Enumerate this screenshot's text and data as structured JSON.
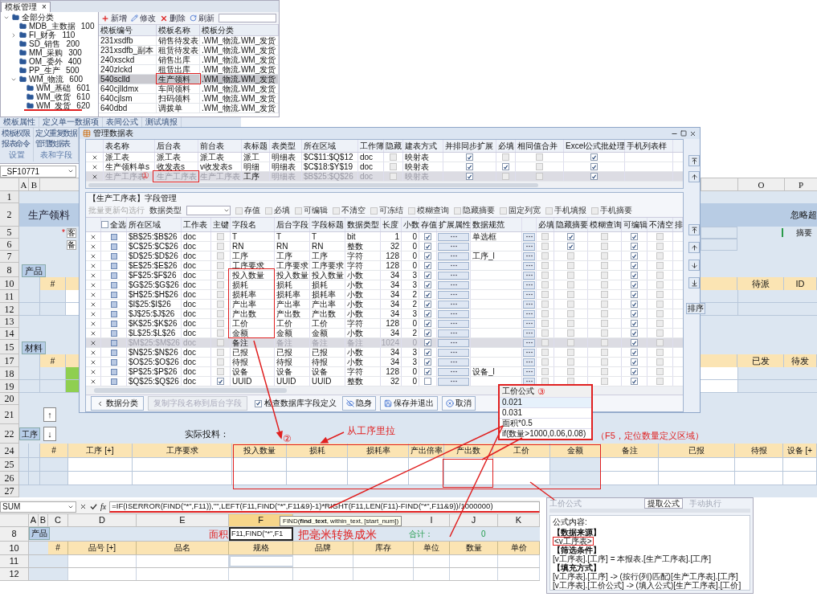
{
  "template_manager": {
    "tab": "模板管理",
    "close": "×",
    "tree": [
      {
        "label": "全部分类",
        "expanded": true,
        "children": [
          {
            "label": "MDB_主数据",
            "code": "100"
          },
          {
            "label": "FI_财务",
            "code": "110",
            "expanded": false
          },
          {
            "label": "SD_销售",
            "code": "200"
          },
          {
            "label": "MM_采购",
            "code": "300"
          },
          {
            "label": "OM_委外",
            "code": "400"
          },
          {
            "label": "PP_生产",
            "code": "500"
          },
          {
            "label": "WM_物流",
            "code": "600",
            "expanded": true,
            "children": [
              {
                "label": "WM_基础",
                "code": "601"
              },
              {
                "label": "WM_收货",
                "code": "610"
              },
              {
                "label": "WM_发货",
                "code": "620"
              }
            ]
          }
        ]
      }
    ],
    "toolbar": [
      {
        "kind": "add",
        "label": "新增"
      },
      {
        "kind": "edit",
        "label": "修改"
      },
      {
        "kind": "delete",
        "label": "删除"
      },
      {
        "kind": "refresh",
        "label": "刷新"
      }
    ],
    "columns": [
      "模板编号",
      "模板名称",
      "模板分类"
    ],
    "rows": [
      {
        "code": "231xsdfb",
        "name": "销售待发表",
        "category": ".WM_物流.WM_发货",
        "selected": false
      },
      {
        "code": "231xsdfb_副本",
        "name": "租赁待发表",
        "category": ".WM_物流.WM_发货",
        "selected": false
      },
      {
        "code": "240xsckd",
        "name": "销售出库",
        "category": ".WM_物流.WM_发货",
        "selected": false
      },
      {
        "code": "240zlckd",
        "name": "租赁出库",
        "category": ".WM_物流.WM_发货",
        "selected": false
      },
      {
        "code": "540sclld",
        "name": "生产领料",
        "category": ".WM_物流.WM_发货",
        "selected": true
      },
      {
        "code": "640cjlldmx",
        "name": "车间领料",
        "category": ".WM_物流.WM_发货",
        "selected": false
      },
      {
        "code": "640cjlsm",
        "name": "扫码领料",
        "category": ".WM_物流.WM_发货",
        "selected": false
      },
      {
        "code": "640dbd",
        "name": "调拨单",
        "category": ".WM_物流.WM_发货",
        "selected": false
      }
    ]
  },
  "ribbon": {
    "tabs": [
      "模板属性",
      "定义单一数据项",
      "表间公式",
      "测试填报"
    ],
    "groups": [
      {
        "items": [
          "模板权限",
          "报表命令"
        ],
        "label": "设置"
      },
      {
        "items": [
          "定义重复数据",
          "管理数据表"
        ],
        "label": "表和字段"
      }
    ]
  },
  "sheet": {
    "name_box": "_SF10771",
    "letters_left": [
      "A",
      "B"
    ],
    "letters_right": [
      "O",
      "P"
    ],
    "rows": [
      {
        "num": "1",
        "kind": "blank"
      },
      {
        "num": "2",
        "kind": "title",
        "text": "生产领料",
        "right_text": "忽略超"
      },
      {
        "num": "5",
        "kind": "field",
        "mark": "*",
        "text": "客",
        "right_text": "摘要"
      },
      {
        "num": "6",
        "kind": "field",
        "text": "备"
      },
      {
        "num": "7",
        "kind": "blank"
      },
      {
        "num": "8",
        "kind": "section",
        "text": "产品"
      },
      {
        "num": "10",
        "kind": "header",
        "text": "#",
        "right_cells": [
          "待派",
          "ID"
        ]
      },
      {
        "num": "11",
        "kind": "grid"
      },
      {
        "num": "12",
        "kind": "grid"
      },
      {
        "num": "13",
        "kind": "blank"
      },
      {
        "num": "14",
        "kind": "blank"
      },
      {
        "num": "15",
        "kind": "section",
        "text": "材料"
      },
      {
        "num": "17",
        "kind": "header",
        "text": "#",
        "right_cells": [
          "已发",
          "待发"
        ]
      },
      {
        "num": "18",
        "kind": "grid_green"
      },
      {
        "num": "19",
        "kind": "grid_green"
      },
      {
        "num": "20",
        "kind": "blank"
      },
      {
        "num": "21",
        "kind": "button",
        "button": "↑"
      },
      {
        "num": "22",
        "kind": "process",
        "text": "工序",
        "button": "↓",
        "note": "实际投料："
      },
      {
        "num": "24",
        "kind": "table_header",
        "cells": [
          "#",
          "工序 [+]",
          "工序要求",
          "投入数量",
          "损耗",
          "损耗率",
          "产出倍率",
          "产出数",
          "工价",
          "金额",
          "备注",
          "已报",
          "待报",
          "设备 [+"
        ]
      },
      {
        "num": "25",
        "kind": "table_row"
      },
      {
        "num": "26",
        "kind": "table_row"
      },
      {
        "num": "27",
        "kind": "blank"
      }
    ]
  },
  "dialog": {
    "title": "管理数据表",
    "table_columns": [
      "表名称",
      "后台表",
      "前台表",
      "表标题",
      "表类型",
      "所在区域",
      "工作簿",
      "隐藏",
      "建表方式",
      "并排同步扩展",
      "必填",
      "相同值合并",
      "Excel公式批处理",
      "手机列表样"
    ],
    "tables": [
      {
        "name": "派工表",
        "backend": "派工表",
        "front": "派工表",
        "title": "派工",
        "type": "明细表",
        "area": "$C$11:$Q$12",
        "book": "doc",
        "hidden": false,
        "build": "映射表",
        "sync": true,
        "required": false,
        "merge": false,
        "excel": true,
        "selected": false
      },
      {
        "name": "生产领料单s",
        "backend": "收发表s",
        "front": "v收发表s",
        "title": "明细",
        "type": "明细表",
        "area": "$C$18:$Y$19",
        "book": "doc",
        "hidden": false,
        "build": "映射表",
        "sync": true,
        "required": true,
        "merge": false,
        "excel": true,
        "selected": false
      },
      {
        "name": "生产工序表",
        "backend": "生产工序表",
        "front": "生产工序表",
        "title": "工序",
        "type": "明细表",
        "area": "$B$25:$Q$26",
        "book": "doc",
        "hidden": false,
        "build": "映射表",
        "sync": true,
        "required": false,
        "merge": false,
        "excel": true,
        "selected": true
      }
    ],
    "fields_title": "【生产工序表】字段管理",
    "batch_label": "批量更新勾选行",
    "type_label": "数据类型",
    "toggles": [
      {
        "label": "存值",
        "checked": false
      },
      {
        "label": "必填",
        "checked": false
      },
      {
        "label": "可编辑",
        "checked": false
      },
      {
        "label": "不清空",
        "checked": false
      },
      {
        "label": "可冻结",
        "checked": false
      },
      {
        "label": "模糊查询",
        "checked": false
      },
      {
        "label": "隐藏摘要",
        "checked": false
      },
      {
        "label": "固定列宽",
        "checked": false
      },
      {
        "label": "手机填报",
        "checked": false
      },
      {
        "label": "手机摘要",
        "checked": false
      }
    ],
    "select_all": {
      "label": "全选",
      "checked": false
    },
    "field_columns": [
      "所在区域",
      "工作表",
      "主键",
      "字段名",
      "后台字段",
      "字段标题",
      "数据类型",
      "长度",
      "小数",
      "存值",
      "扩展属性",
      "数据规范",
      "",
      "必填",
      "隐藏摘要",
      "模糊查询",
      "可编辑",
      "不清空",
      "排"
    ],
    "fields": [
      {
        "area": "$B$25:$B$26",
        "sheet": "doc",
        "key": false,
        "name": "T",
        "backend": "T",
        "title": "T",
        "type": "bit",
        "length": "1",
        "decimals": "0",
        "store": true,
        "spec": "单选框",
        "required": false,
        "hide_summary": true,
        "fuzzy": false,
        "editable": true,
        "keep": false,
        "checked": false,
        "disabled": false
      },
      {
        "area": "$C$25:$C$26",
        "sheet": "doc",
        "key": false,
        "name": "RN",
        "backend": "RN",
        "title": "RN",
        "type": "整数",
        "length": "32",
        "decimals": "0",
        "store": true,
        "required": false,
        "hide_summary": true,
        "fuzzy": false,
        "editable": true,
        "keep": false,
        "checked": false,
        "disabled": false
      },
      {
        "area": "$D$25:$D$26",
        "sheet": "doc",
        "key": false,
        "name": "工序",
        "backend": "工序",
        "title": "工序",
        "type": "字符",
        "length": "128",
        "decimals": "0",
        "store": true,
        "spec": "工序_l",
        "required": false,
        "hide_summary": false,
        "fuzzy": false,
        "editable": true,
        "keep": false,
        "checked": false,
        "disabled": false
      },
      {
        "area": "$E$25:$E$26",
        "sheet": "doc",
        "key": false,
        "name": "工序要求",
        "backend": "工序要求",
        "title": "工序要求",
        "type": "字符",
        "length": "128",
        "decimals": "0",
        "store": true,
        "required": false,
        "hide_summary": false,
        "fuzzy": false,
        "editable": true,
        "keep": false,
        "checked": false,
        "disabled": false
      },
      {
        "area": "$F$25:$F$26",
        "sheet": "doc",
        "key": false,
        "name": "投入数量",
        "backend": "投入数量",
        "title": "投入数量",
        "type": "小数",
        "length": "34",
        "decimals": "3",
        "store": true,
        "required": false,
        "hide_summary": false,
        "fuzzy": false,
        "editable": true,
        "keep": false,
        "checked": false,
        "disabled": false
      },
      {
        "area": "$G$25:$G$26",
        "sheet": "doc",
        "key": false,
        "name": "损耗",
        "backend": "损耗",
        "title": "损耗",
        "type": "小数",
        "length": "34",
        "decimals": "3",
        "store": true,
        "required": false,
        "hide_summary": false,
        "fuzzy": false,
        "editable": true,
        "keep": false,
        "checked": false,
        "disabled": false
      },
      {
        "area": "$H$25:$H$26",
        "sheet": "doc",
        "key": false,
        "name": "损耗率",
        "backend": "损耗率",
        "title": "损耗率",
        "type": "小数",
        "length": "34",
        "decimals": "2",
        "store": true,
        "required": false,
        "hide_summary": false,
        "fuzzy": false,
        "editable": true,
        "keep": false,
        "checked": false,
        "disabled": false
      },
      {
        "area": "$I$25:$I$26",
        "sheet": "doc",
        "key": false,
        "name": "产出率",
        "backend": "产出率",
        "title": "产出率",
        "type": "小数",
        "length": "34",
        "decimals": "2",
        "store": true,
        "required": false,
        "hide_summary": false,
        "fuzzy": false,
        "editable": true,
        "keep": false,
        "checked": false,
        "disabled": false
      },
      {
        "area": "$J$25:$J$26",
        "sheet": "doc",
        "key": false,
        "name": "产出数",
        "backend": "产出数",
        "title": "产出数",
        "type": "小数",
        "length": "34",
        "decimals": "3",
        "store": true,
        "required": false,
        "hide_summary": false,
        "fuzzy": false,
        "editable": true,
        "keep": false,
        "checked": false,
        "disabled": false
      },
      {
        "area": "$K$25:$K$26",
        "sheet": "doc",
        "key": false,
        "name": "工价",
        "backend": "工价",
        "title": "工价",
        "type": "字符",
        "length": "128",
        "decimals": "0",
        "store": true,
        "required": false,
        "hide_summary": false,
        "fuzzy": false,
        "editable": true,
        "keep": false,
        "checked": false,
        "disabled": false
      },
      {
        "area": "$L$25:$L$26",
        "sheet": "doc",
        "key": false,
        "name": "金额",
        "backend": "金额",
        "title": "金额",
        "type": "小数",
        "length": "34",
        "decimals": "2",
        "store": true,
        "required": false,
        "hide_summary": false,
        "fuzzy": false,
        "editable": true,
        "keep": false,
        "checked": false,
        "disabled": false
      },
      {
        "area": "$M$25:$M$26",
        "sheet": "doc",
        "key": false,
        "name": "备注",
        "backend": "备注",
        "title": "备注",
        "type": "备注",
        "length": "1024",
        "decimals": "0",
        "store": true,
        "required": false,
        "hide_summary": false,
        "fuzzy": false,
        "editable": true,
        "keep": false,
        "checked": false,
        "disabled": true
      },
      {
        "area": "$N$25:$N$26",
        "sheet": "doc",
        "key": false,
        "name": "已报",
        "backend": "已报",
        "title": "已报",
        "type": "小数",
        "length": "34",
        "decimals": "3",
        "store": true,
        "required": false,
        "hide_summary": false,
        "fuzzy": false,
        "editable": true,
        "keep": false,
        "checked": false,
        "disabled": false
      },
      {
        "area": "$O$25:$O$26",
        "sheet": "doc",
        "key": false,
        "name": "待报",
        "backend": "待报",
        "title": "待报",
        "type": "小数",
        "length": "34",
        "decimals": "3",
        "store": true,
        "required": false,
        "hide_summary": false,
        "fuzzy": false,
        "editable": true,
        "keep": false,
        "checked": false,
        "disabled": false
      },
      {
        "area": "$P$25:$P$26",
        "sheet": "doc",
        "key": false,
        "name": "设备",
        "backend": "设备",
        "title": "设备",
        "type": "字符",
        "length": "128",
        "decimals": "0",
        "store": true,
        "spec": "设备_l",
        "required": false,
        "hide_summary": false,
        "fuzzy": false,
        "editable": true,
        "keep": false,
        "checked": false,
        "disabled": false
      },
      {
        "area": "$Q$25:$Q$26",
        "sheet": "doc",
        "key": true,
        "name": "UUID",
        "backend": "UUID",
        "title": "UUID",
        "type": "整数",
        "length": "32",
        "decimals": "0",
        "store": false,
        "required": false,
        "hide_summary": false,
        "fuzzy": false,
        "editable": true,
        "keep": false,
        "checked": false,
        "disabled": false
      }
    ],
    "sort_button": "排序",
    "buttons": [
      {
        "kind": "back",
        "label": "数据分类",
        "disabled": false
      },
      {
        "kind": "plain",
        "label": "复制字段名称到后台字段",
        "disabled": true
      }
    ],
    "check_db": {
      "label": "检查数据库字段定义",
      "checked": true
    },
    "actions": [
      {
        "kind": "hide",
        "label": "隐身"
      },
      {
        "kind": "save",
        "label": "保存并退出"
      },
      {
        "kind": "cancel",
        "label": "取消"
      }
    ]
  },
  "popup": {
    "title": "工价公式",
    "mark": "③",
    "rows": [
      {
        "text": "0.021",
        "selected": true
      },
      {
        "text": "0.031",
        "selected": false
      },
      {
        "text": "面积*0.5",
        "selected": false
      },
      {
        "text": "if(数量>1000,0.06,0.08)",
        "selected": false
      }
    ]
  },
  "annotations": {
    "circle_1": "①",
    "circle_2": "②",
    "pull_note": "从工序里拉",
    "f5_note": "（F5，定位数量定义区域）"
  },
  "excel": {
    "name_box": "SUM",
    "fx": "fx",
    "formula": "=IF(ISERROR(FIND(\"*\",F11)),\"\",LEFT(F11,FIND(\"*\",F11&9)-1)*RIGHT(F11,LEN(F11)-FIND(\"*\",F11&9))/1000000)",
    "tooltip": "FIND(**find_text**, within_text, [start_num])",
    "letters": [
      "A",
      "B",
      "C",
      "D",
      "E",
      "F",
      "I",
      "J",
      "K"
    ],
    "row8": {
      "num": "8",
      "section": "产品",
      "area_label": "面积",
      "cell": "F11,FIND(\"*\",F1",
      "convert_note": "把毫米转换成米",
      "total_label": "合计：",
      "total": "0"
    },
    "row10": {
      "num": "10",
      "headers": [
        "#",
        "品号 [+]",
        "品名",
        "规格",
        "品牌",
        "库存",
        "单位",
        "数量",
        "单价"
      ]
    },
    "rows": [
      "11",
      "12"
    ]
  },
  "formula_panel": {
    "label": "工价公式",
    "tab": "提取公式",
    "manual": "手动执行",
    "content_label": "公式内容:",
    "lines": [
      {
        "kind": "heading",
        "text": "【数据来源】"
      },
      {
        "kind": "source",
        "text": "<v工序表>"
      },
      {
        "kind": "heading",
        "text": "【筛选条件】"
      },
      {
        "kind": "line",
        "text": "[v工序表].[工序] = 本报表.[生产工序表].[工序]"
      },
      {
        "kind": "heading",
        "text": "【填充方式】"
      },
      {
        "kind": "line",
        "text": "[v工序表].[工序]  -> (按行(列)匹配)[生产工序表].[工序]"
      },
      {
        "kind": "line",
        "text": "[v工序表].[工价公式]  -> (填入公式)[生产工序表].[工价]"
      }
    ]
  }
}
